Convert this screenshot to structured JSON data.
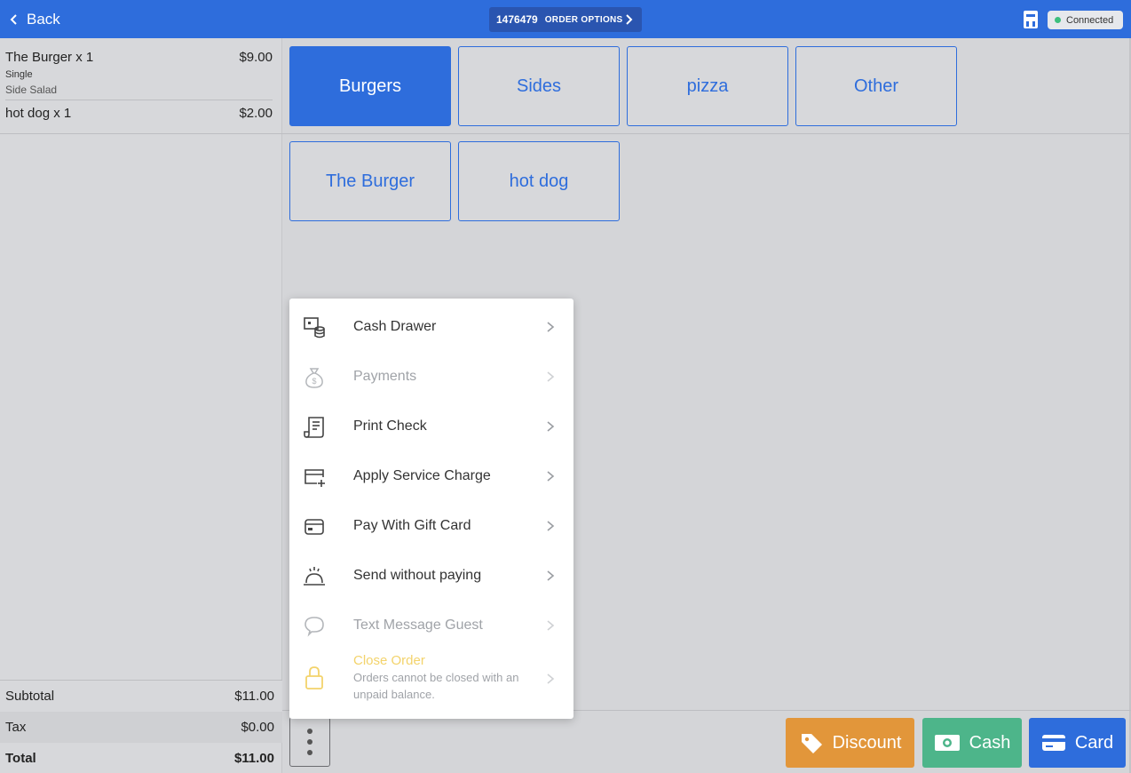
{
  "topbar": {
    "back_label": "Back",
    "order_number": "1476479",
    "order_options_label": "ORDER OPTIONS",
    "connection_status": "Connected",
    "connection_color": "#3cbf7d",
    "bar_color": "#2e6ddc"
  },
  "order": {
    "items": [
      {
        "name": "The Burger x 1",
        "price": "$9.00",
        "modifiers": [
          "Single",
          "Side Salad"
        ]
      },
      {
        "name": "hot dog x 1",
        "price": "$2.00",
        "modifiers": []
      }
    ],
    "subtotal_label": "Subtotal",
    "subtotal": "$11.00",
    "tax_label": "Tax",
    "tax": "$0.00",
    "total_label": "Total",
    "total": "$11.00"
  },
  "categories": [
    {
      "label": "Burgers",
      "selected": true
    },
    {
      "label": "Sides",
      "selected": false
    },
    {
      "label": "pizza",
      "selected": false
    },
    {
      "label": "Other",
      "selected": false
    }
  ],
  "menu_items": [
    "The Burger",
    "hot dog"
  ],
  "options_menu": {
    "items": [
      {
        "label": "Cash Drawer",
        "icon": "cash-drawer-icon",
        "enabled": true
      },
      {
        "label": "Payments",
        "icon": "money-bag-icon",
        "enabled": false
      },
      {
        "label": "Print Check",
        "icon": "receipt-icon",
        "enabled": true
      },
      {
        "label": "Apply Service Charge",
        "icon": "card-plus-icon",
        "enabled": true
      },
      {
        "label": "Pay With Gift Card",
        "icon": "gift-card-icon",
        "enabled": true
      },
      {
        "label": "Send without paying",
        "icon": "cloche-icon",
        "enabled": true
      },
      {
        "label": "Text Message Guest",
        "icon": "chat-bubble-icon",
        "enabled": false
      }
    ],
    "close_order": {
      "title": "Close Order",
      "description": "Orders cannot be closed with an unpaid balance.",
      "icon": "lock-icon",
      "enabled": false
    }
  },
  "actions": {
    "more_icon": "vertical-dots-icon",
    "discount_label": "Discount",
    "discount_color": "#e2963a",
    "cash_label": "Cash",
    "cash_color": "#4db58a",
    "card_label": "Card",
    "card_color": "#2e6ddc"
  }
}
